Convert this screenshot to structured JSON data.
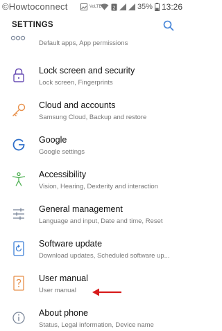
{
  "status_bar": {
    "watermark": "©Howtoconnect",
    "volte": "VoLTE",
    "battery": "35%",
    "time": "13:26"
  },
  "header": {
    "title": "SETTINGS"
  },
  "partial_item": {
    "subtitle": "Default apps, App permissions"
  },
  "items": [
    {
      "title": "Lock screen and security",
      "subtitle": "Lock screen, Fingerprints",
      "icon": "lock-icon"
    },
    {
      "title": "Cloud and accounts",
      "subtitle": "Samsung Cloud, Backup and restore",
      "icon": "key-icon"
    },
    {
      "title": "Google",
      "subtitle": "Google settings",
      "icon": "google-icon"
    },
    {
      "title": "Accessibility",
      "subtitle": "Vision, Hearing, Dexterity and interaction",
      "icon": "accessibility-icon"
    },
    {
      "title": "General management",
      "subtitle": "Language and input, Date and time, Reset",
      "icon": "sliders-icon"
    },
    {
      "title": "Software update",
      "subtitle": "Download updates, Scheduled software up...",
      "icon": "software-update-icon"
    },
    {
      "title": "User manual",
      "subtitle": "User manual",
      "icon": "user-manual-icon"
    },
    {
      "title": "About phone",
      "subtitle": "Status, Legal information, Device name",
      "icon": "info-icon"
    }
  ],
  "colors": {
    "accent": "#3d7fd6",
    "arrow": "#d81b1b",
    "icon_lock": "#6a4fb5",
    "icon_key": "#e8904a",
    "icon_google": "#2f6fc9",
    "icon_accessibility": "#4caf50",
    "icon_sliders": "#7a8699",
    "icon_update": "#3d7fd6",
    "icon_manual": "#e8904a",
    "icon_info": "#7a8699"
  }
}
